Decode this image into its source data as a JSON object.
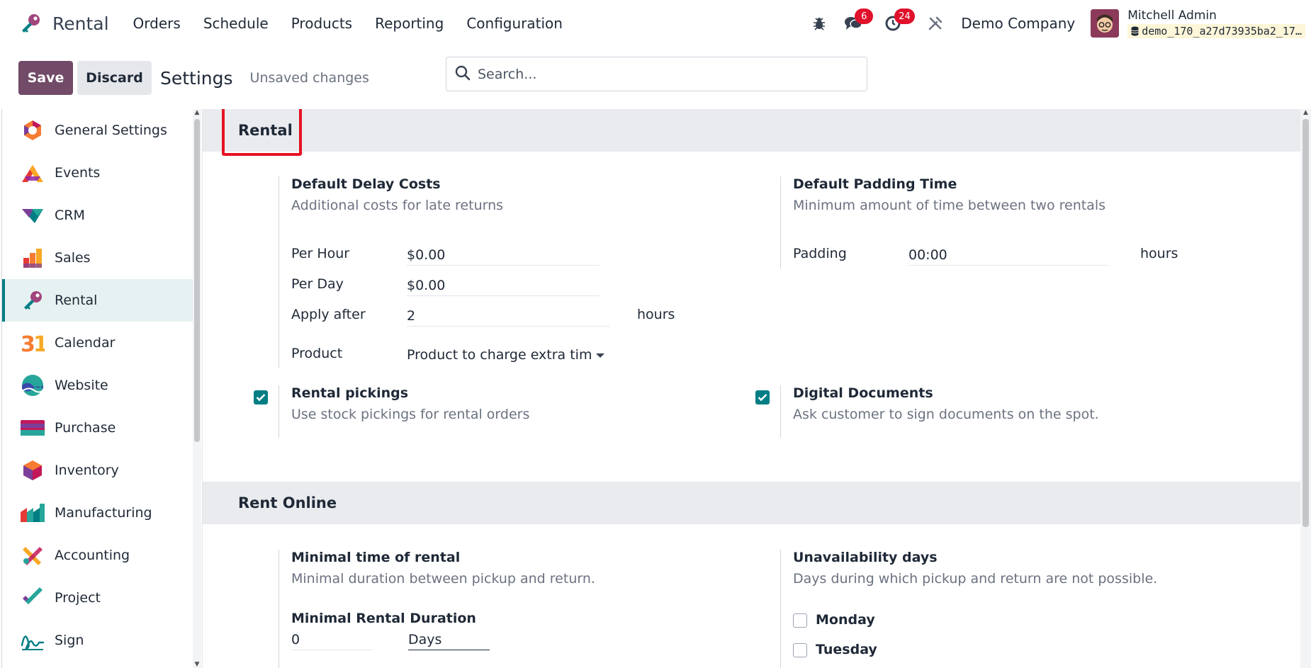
{
  "navbar": {
    "app_name": "Rental",
    "menu": [
      "Orders",
      "Schedule",
      "Products",
      "Reporting",
      "Configuration"
    ],
    "messages_count": "6",
    "activities_count": "24",
    "company": "Demo Company",
    "user_name": "Mitchell Admin",
    "database": "demo_170_a27d73935ba2_17…"
  },
  "control": {
    "save_label": "Save",
    "discard_label": "Discard",
    "title": "Settings",
    "unsaved": "Unsaved changes",
    "search_placeholder": "Search..."
  },
  "sidebar": {
    "items": [
      {
        "label": "General Settings",
        "icon": "general-settings-icon"
      },
      {
        "label": "Events",
        "icon": "events-icon"
      },
      {
        "label": "CRM",
        "icon": "crm-icon"
      },
      {
        "label": "Sales",
        "icon": "sales-icon"
      },
      {
        "label": "Rental",
        "icon": "rental-icon",
        "active": true
      },
      {
        "label": "Calendar",
        "icon": "calendar-icon"
      },
      {
        "label": "Website",
        "icon": "website-icon"
      },
      {
        "label": "Purchase",
        "icon": "purchase-icon"
      },
      {
        "label": "Inventory",
        "icon": "inventory-icon"
      },
      {
        "label": "Manufacturing",
        "icon": "manufacturing-icon"
      },
      {
        "label": "Accounting",
        "icon": "accounting-icon"
      },
      {
        "label": "Project",
        "icon": "project-icon"
      },
      {
        "label": "Sign",
        "icon": "sign-icon"
      }
    ]
  },
  "rental": {
    "heading": "Rental",
    "delay_costs": {
      "title": "Default Delay Costs",
      "desc": "Additional costs for late returns",
      "per_hour_label": "Per Hour",
      "per_hour_value": "$0.00",
      "per_day_label": "Per Day",
      "per_day_value": "$0.00",
      "apply_after_label": "Apply after",
      "apply_after_value": "2",
      "apply_after_unit": "hours",
      "product_label": "Product",
      "product_value": "Product to charge extra tim"
    },
    "padding": {
      "title": "Default Padding Time",
      "desc": "Minimum amount of time between two rentals",
      "label": "Padding",
      "value": "00:00",
      "unit": "hours"
    },
    "pickings": {
      "title": "Rental pickings",
      "desc": "Use stock pickings for rental orders",
      "checked": true
    },
    "digital_docs": {
      "title": "Digital Documents",
      "desc": "Ask customer to sign documents on the spot.",
      "checked": true
    }
  },
  "rent_online": {
    "heading": "Rent Online",
    "minimal_time": {
      "title": "Minimal time of rental",
      "desc": "Minimal duration between pickup and return.",
      "duration_label": "Minimal Rental Duration",
      "duration_value": "0",
      "duration_unit": "Days"
    },
    "unavailability": {
      "title": "Unavailability days",
      "desc": "Days during which pickup and return are not possible.",
      "days": [
        {
          "label": "Monday",
          "checked": false
        },
        {
          "label": "Tuesday",
          "checked": false
        }
      ]
    }
  },
  "colors": {
    "brand": "#714b67",
    "accent": "#017e84",
    "badge": "#e0112b",
    "highlight": "#e81123"
  }
}
